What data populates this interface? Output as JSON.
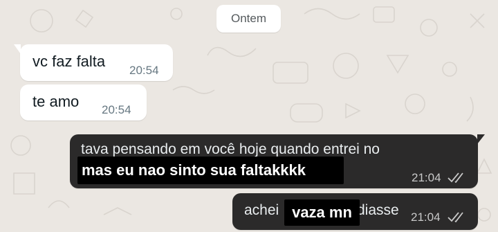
{
  "date_separator": "Ontem",
  "messages": [
    {
      "text": "vc faz falta",
      "time": "20:54"
    },
    {
      "text": "te amo",
      "time": "20:54"
    },
    {
      "text": "tava pensando em você hoje quando entrei no",
      "overlay": "mas eu nao sinto sua faltakkkk",
      "time": "21:04",
      "status": "double-check-icon"
    },
    {
      "text_before": "achei",
      "text_after": "diasse",
      "overlay": "vaza mn",
      "time": "21:04",
      "status": "double-check-icon"
    }
  ],
  "colors": {
    "wallpaper": "#ebe7e2",
    "incoming_bubble": "#ffffff",
    "outgoing_bubble": "#2b2a2a",
    "overlay_box": "#000000"
  }
}
